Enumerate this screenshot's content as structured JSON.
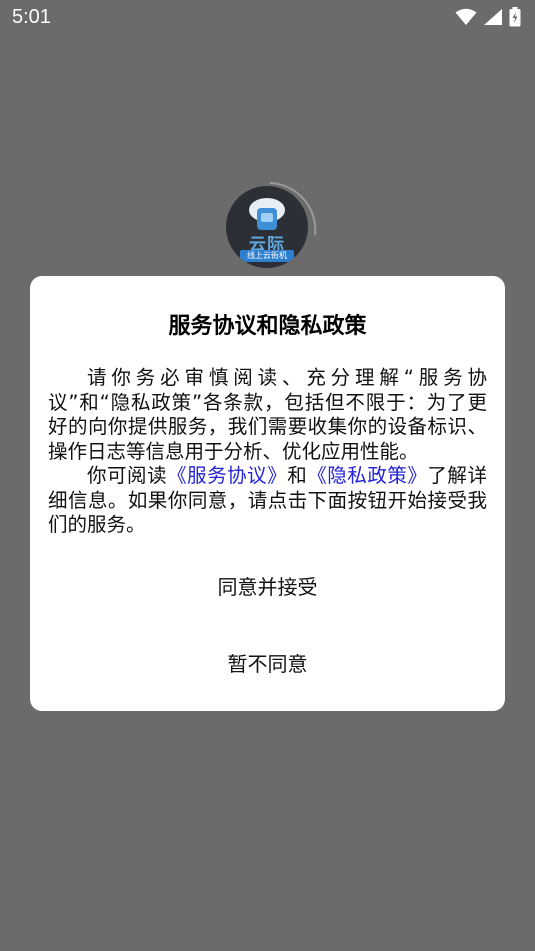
{
  "status_bar": {
    "time": "5:01",
    "icons": [
      "wifi-icon",
      "signal-icon",
      "battery-charging-icon"
    ]
  },
  "logo": {
    "text": "云际",
    "subtitle": "线上云街机"
  },
  "dialog": {
    "title": "服务协议和隐私政策",
    "paragraph1": "请你务必审慎阅读、充分理解“服务协议”和“隐私政策”各条款，包括但不限于：为了更好的向你提供服务，我们需要收集你的设备标识、操作日志等信息用于分析、优化应用性能。",
    "paragraph2_prefix": "你可阅读",
    "link_service": "《服务协议》",
    "paragraph2_and": "和",
    "link_privacy": "《隐私政策》",
    "paragraph2_suffix": "了解详细信息。如果你同意，请点击下面按钮开始接受我们的服务。",
    "agree_label": "同意并接受",
    "disagree_label": "暂不同意"
  },
  "colors": {
    "overlay": "#6b6b6b",
    "dialog_bg": "#ffffff",
    "link": "#2323d8"
  }
}
